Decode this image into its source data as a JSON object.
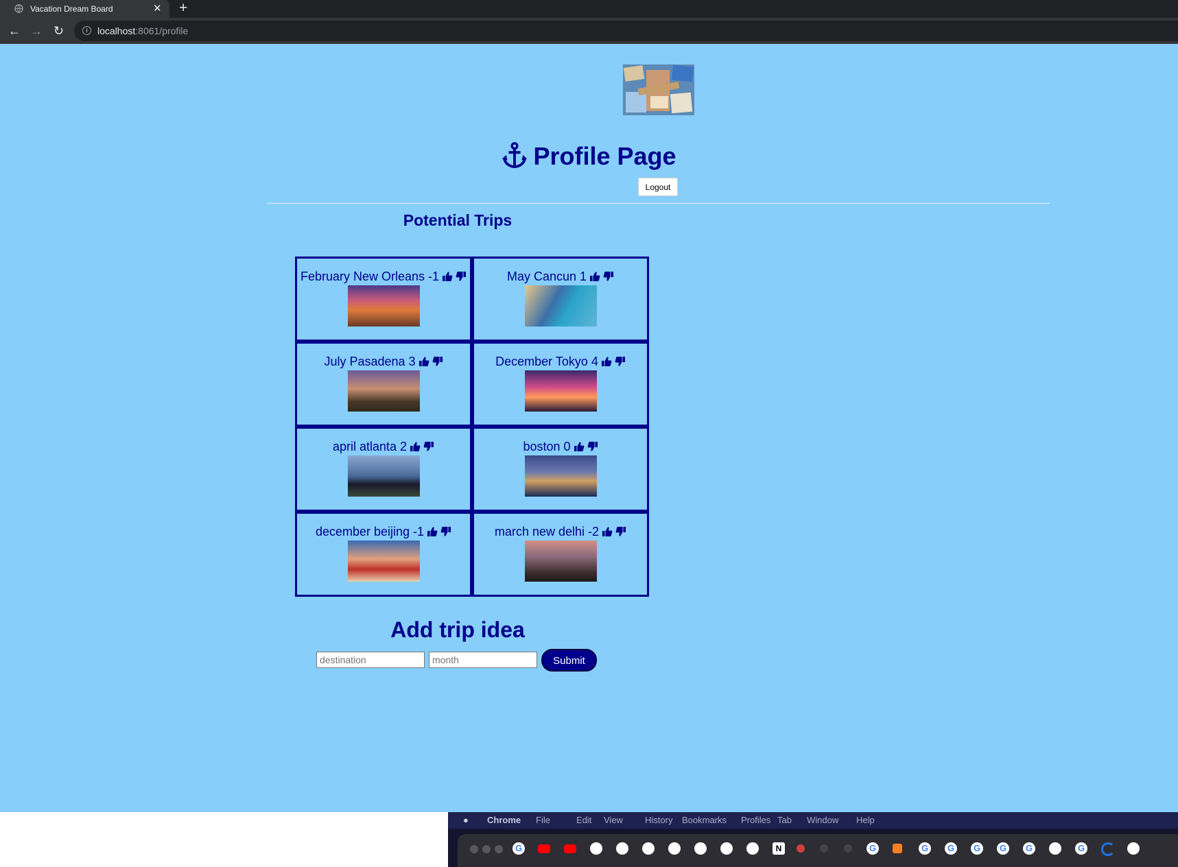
{
  "browser": {
    "tab_title": "Vacation Dream Board",
    "url_host": "localhost",
    "url_rest": ":8061/profile"
  },
  "page": {
    "title": "Profile Page",
    "logout_label": "Logout",
    "potential_trips_title": "Potential Trips",
    "trips": [
      {
        "label": "February New Orleans -1",
        "photo": "new-orleans-street"
      },
      {
        "label": "May Cancun 1",
        "photo": "cancun-beach"
      },
      {
        "label": "July Pasadena 3",
        "photo": "pasadena-night"
      },
      {
        "label": "December Tokyo 4",
        "photo": "tokyo-street"
      },
      {
        "label": "april atlanta 2",
        "photo": "atlanta-skyline"
      },
      {
        "label": "boston 0",
        "photo": "boston-skyline"
      },
      {
        "label": "december beijing -1",
        "photo": "beijing-pagoda"
      },
      {
        "label": "march new delhi -2",
        "photo": "new-delhi-palace"
      }
    ],
    "add_title": "Add trip idea",
    "destination_placeholder": "destination",
    "month_placeholder": "month",
    "submit_label": "Submit"
  },
  "mac_menu": {
    "app": "Chrome",
    "items": [
      "File",
      "Edit",
      "View",
      "History",
      "Bookmarks",
      "Profiles",
      "Tab",
      "Window",
      "Help"
    ]
  },
  "colors": {
    "page_bg": "#87cefa",
    "accent": "#00008b"
  }
}
